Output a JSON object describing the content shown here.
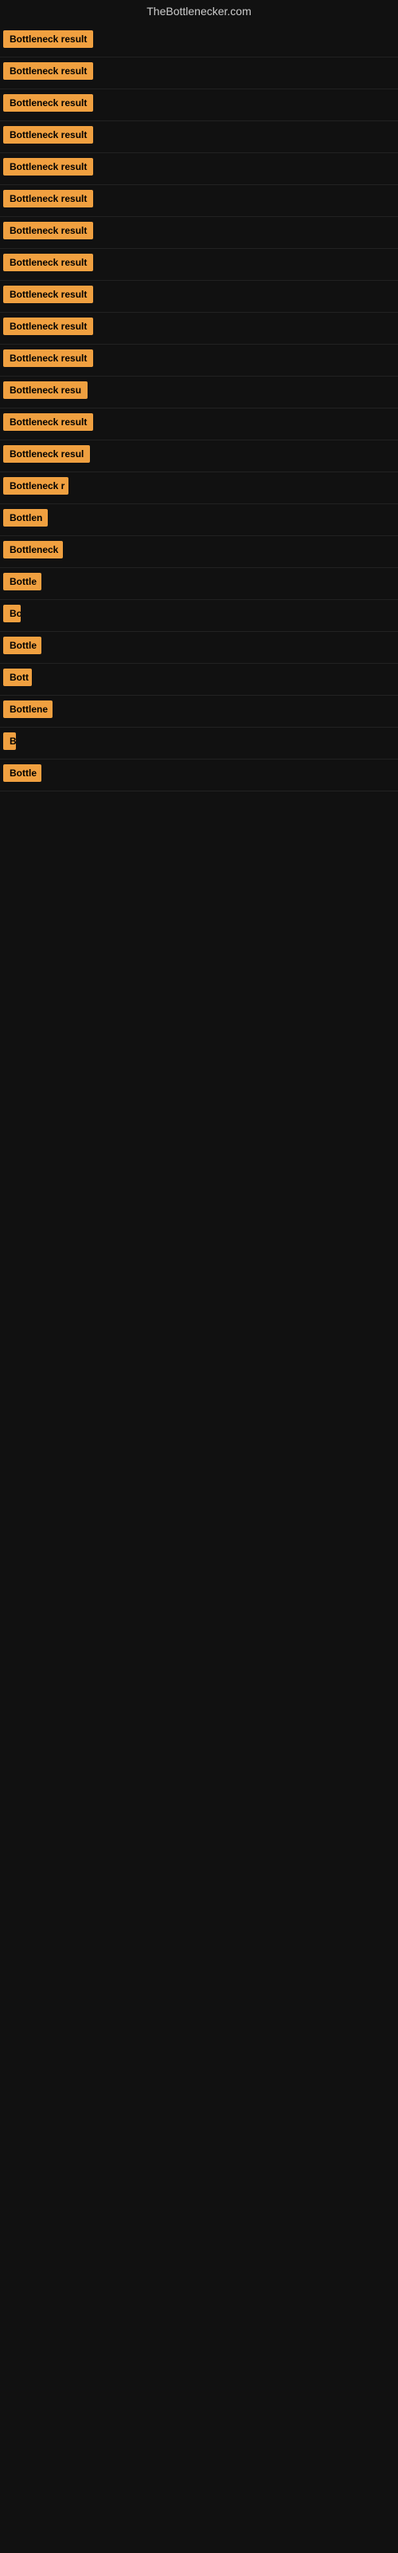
{
  "site": {
    "title": "TheBottlenecker.com"
  },
  "rows": [
    {
      "label": "Bottleneck result",
      "width": 140
    },
    {
      "label": "Bottleneck result",
      "width": 140
    },
    {
      "label": "Bottleneck result",
      "width": 140
    },
    {
      "label": "Bottleneck result",
      "width": 140
    },
    {
      "label": "Bottleneck result",
      "width": 140
    },
    {
      "label": "Bottleneck result",
      "width": 140
    },
    {
      "label": "Bottleneck result",
      "width": 140
    },
    {
      "label": "Bottleneck result",
      "width": 140
    },
    {
      "label": "Bottleneck result",
      "width": 140
    },
    {
      "label": "Bottleneck result",
      "width": 140
    },
    {
      "label": "Bottleneck result",
      "width": 140
    },
    {
      "label": "Bottleneck resu",
      "width": 118
    },
    {
      "label": "Bottleneck result",
      "width": 130
    },
    {
      "label": "Bottleneck resul",
      "width": 120
    },
    {
      "label": "Bottleneck r",
      "width": 82
    },
    {
      "label": "Bottlen",
      "width": 56
    },
    {
      "label": "Bottleneck",
      "width": 75
    },
    {
      "label": "Bottle",
      "width": 48
    },
    {
      "label": "Bo",
      "width": 22
    },
    {
      "label": "Bottle",
      "width": 48
    },
    {
      "label": "Bott",
      "width": 36
    },
    {
      "label": "Bottlene",
      "width": 62
    },
    {
      "label": "B",
      "width": 12
    },
    {
      "label": "Bottle",
      "width": 48
    }
  ],
  "accent_color": "#f0a040"
}
